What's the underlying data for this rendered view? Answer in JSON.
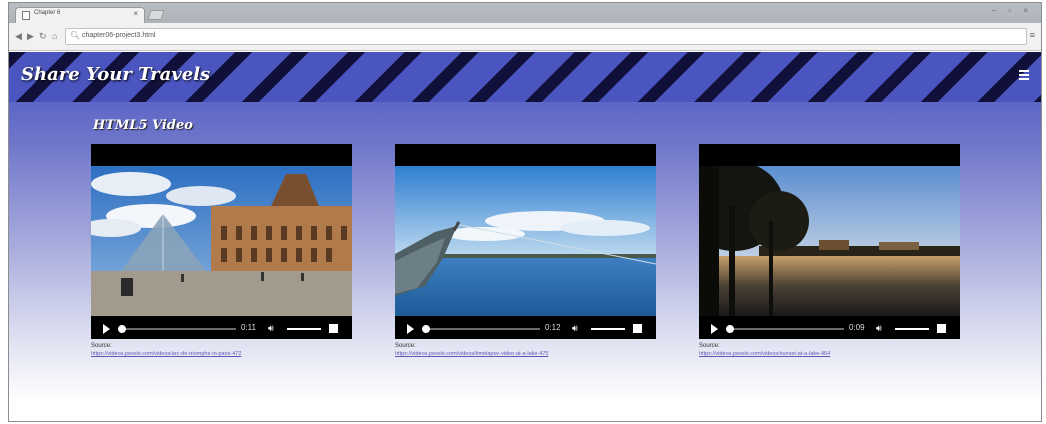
{
  "browser": {
    "tab_title": "Chapter 6",
    "tab_close": "×",
    "address_url": "chapter06-project3.html",
    "window_controls": "– ▫ ×",
    "menu": "≡"
  },
  "site": {
    "title": "Share Your Travels"
  },
  "section": {
    "title": "HTML5 Video"
  },
  "videos": [
    {
      "time": "0:11",
      "source_label": "Source:",
      "source_url": "https://videos.pexels.com/videos/arc-de-triomphe-in-paris-472",
      "progress": 0
    },
    {
      "time": "0:12",
      "source_label": "Source:",
      "source_url": "https://videos.pexels.com/videos/timelapse-video-at-a-lake-475",
      "progress": 0
    },
    {
      "time": "0:09",
      "source_label": "Source:",
      "source_url": "https://videos.pexels.com/videos/sunset-at-a-lake-464",
      "progress": 0
    }
  ],
  "colors": {
    "header_stripe_dark": "#10103a",
    "header_stripe_light": "#4a55c0",
    "link": "#5a5ab4"
  }
}
